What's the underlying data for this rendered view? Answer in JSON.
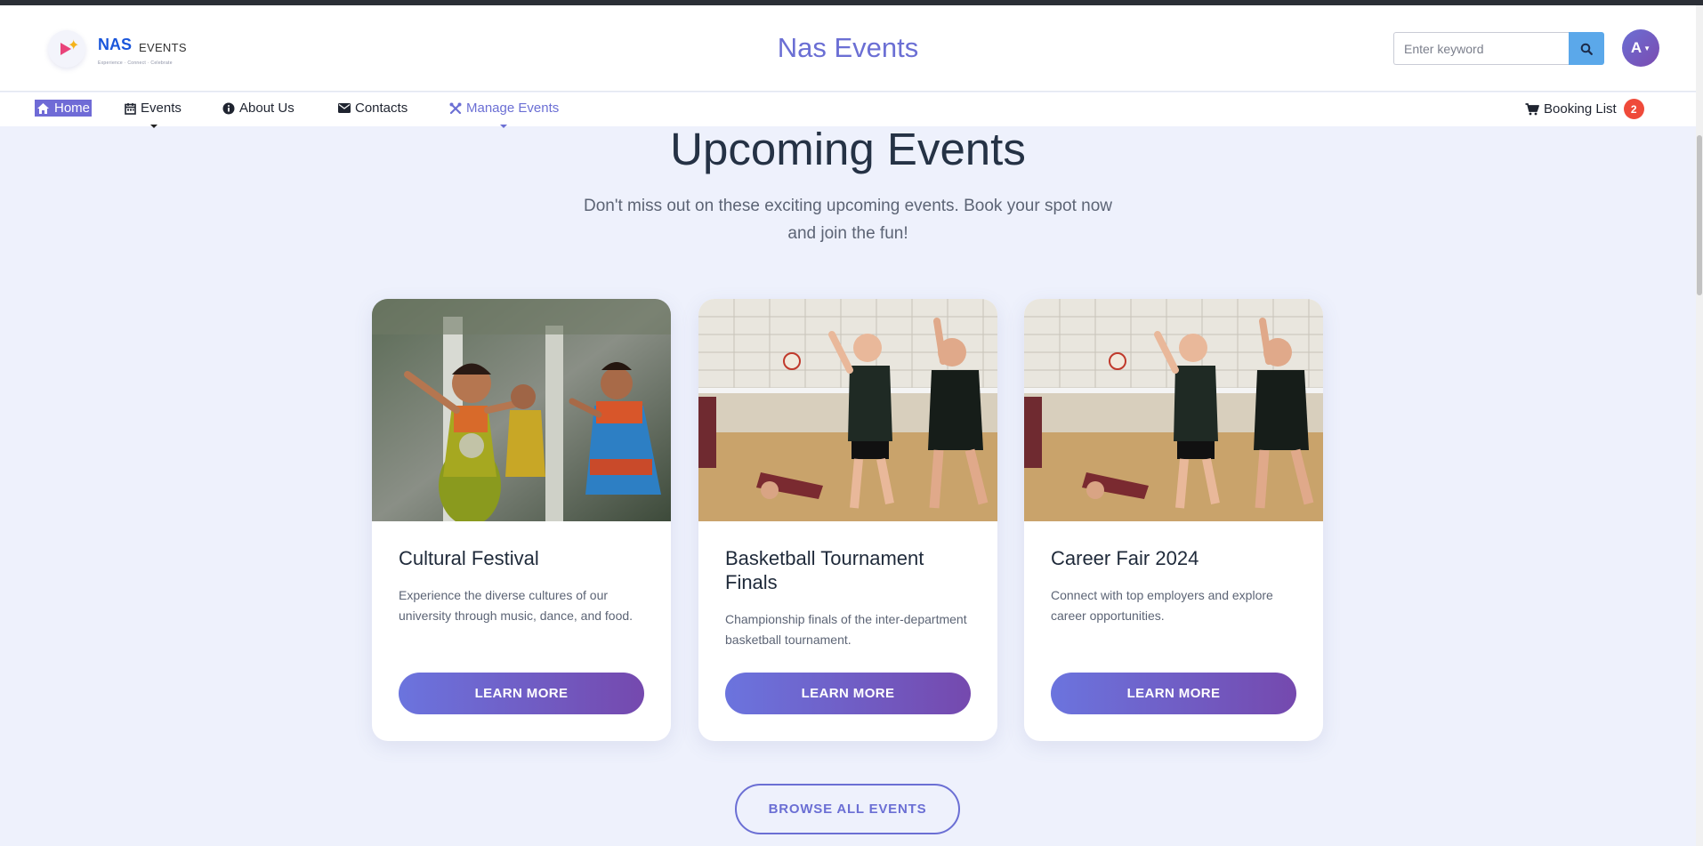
{
  "header": {
    "logo_main": "NAS",
    "logo_sub": "EVENTS",
    "logo_tagline": "Experience · Connect · Celebrate",
    "site_title": "Nas Events",
    "search_placeholder": "Enter keyword",
    "avatar_initial": "A"
  },
  "nav": {
    "items": [
      {
        "label": "Home",
        "icon": "home-icon"
      },
      {
        "label": "Events",
        "icon": "calendar-icon"
      },
      {
        "label": "About Us",
        "icon": "info-icon"
      },
      {
        "label": "Contacts",
        "icon": "envelope-icon"
      },
      {
        "label": "Manage Events",
        "icon": "tools-icon"
      }
    ],
    "booking_label": "Booking List",
    "booking_count": "2"
  },
  "main": {
    "heading": "Upcoming Events",
    "subtext": "Don't miss out on these exciting upcoming events. Book your spot now and join the fun!",
    "cards": [
      {
        "title": "Cultural Festival",
        "desc": "Experience the diverse cultures of our university through music, dance, and food.",
        "button": "LEARN MORE",
        "image": "dancers-photo"
      },
      {
        "title": "Basketball Tournament Finals",
        "desc": "Championship finals of the inter-department basketball tournament.",
        "button": "LEARN MORE",
        "image": "volleyball-photo"
      },
      {
        "title": "Career Fair 2024",
        "desc": "Connect with top employers and explore career opportunities.",
        "button": "LEARN MORE",
        "image": "volleyball-photo"
      }
    ],
    "browse_button": "BROWSE ALL EVENTS"
  },
  "colors": {
    "accent": "#6b6fd4",
    "gradient_start": "#6b74de",
    "gradient_end": "#7549ae",
    "badge": "#ef4a3a",
    "search_button": "#5ba8ea"
  }
}
